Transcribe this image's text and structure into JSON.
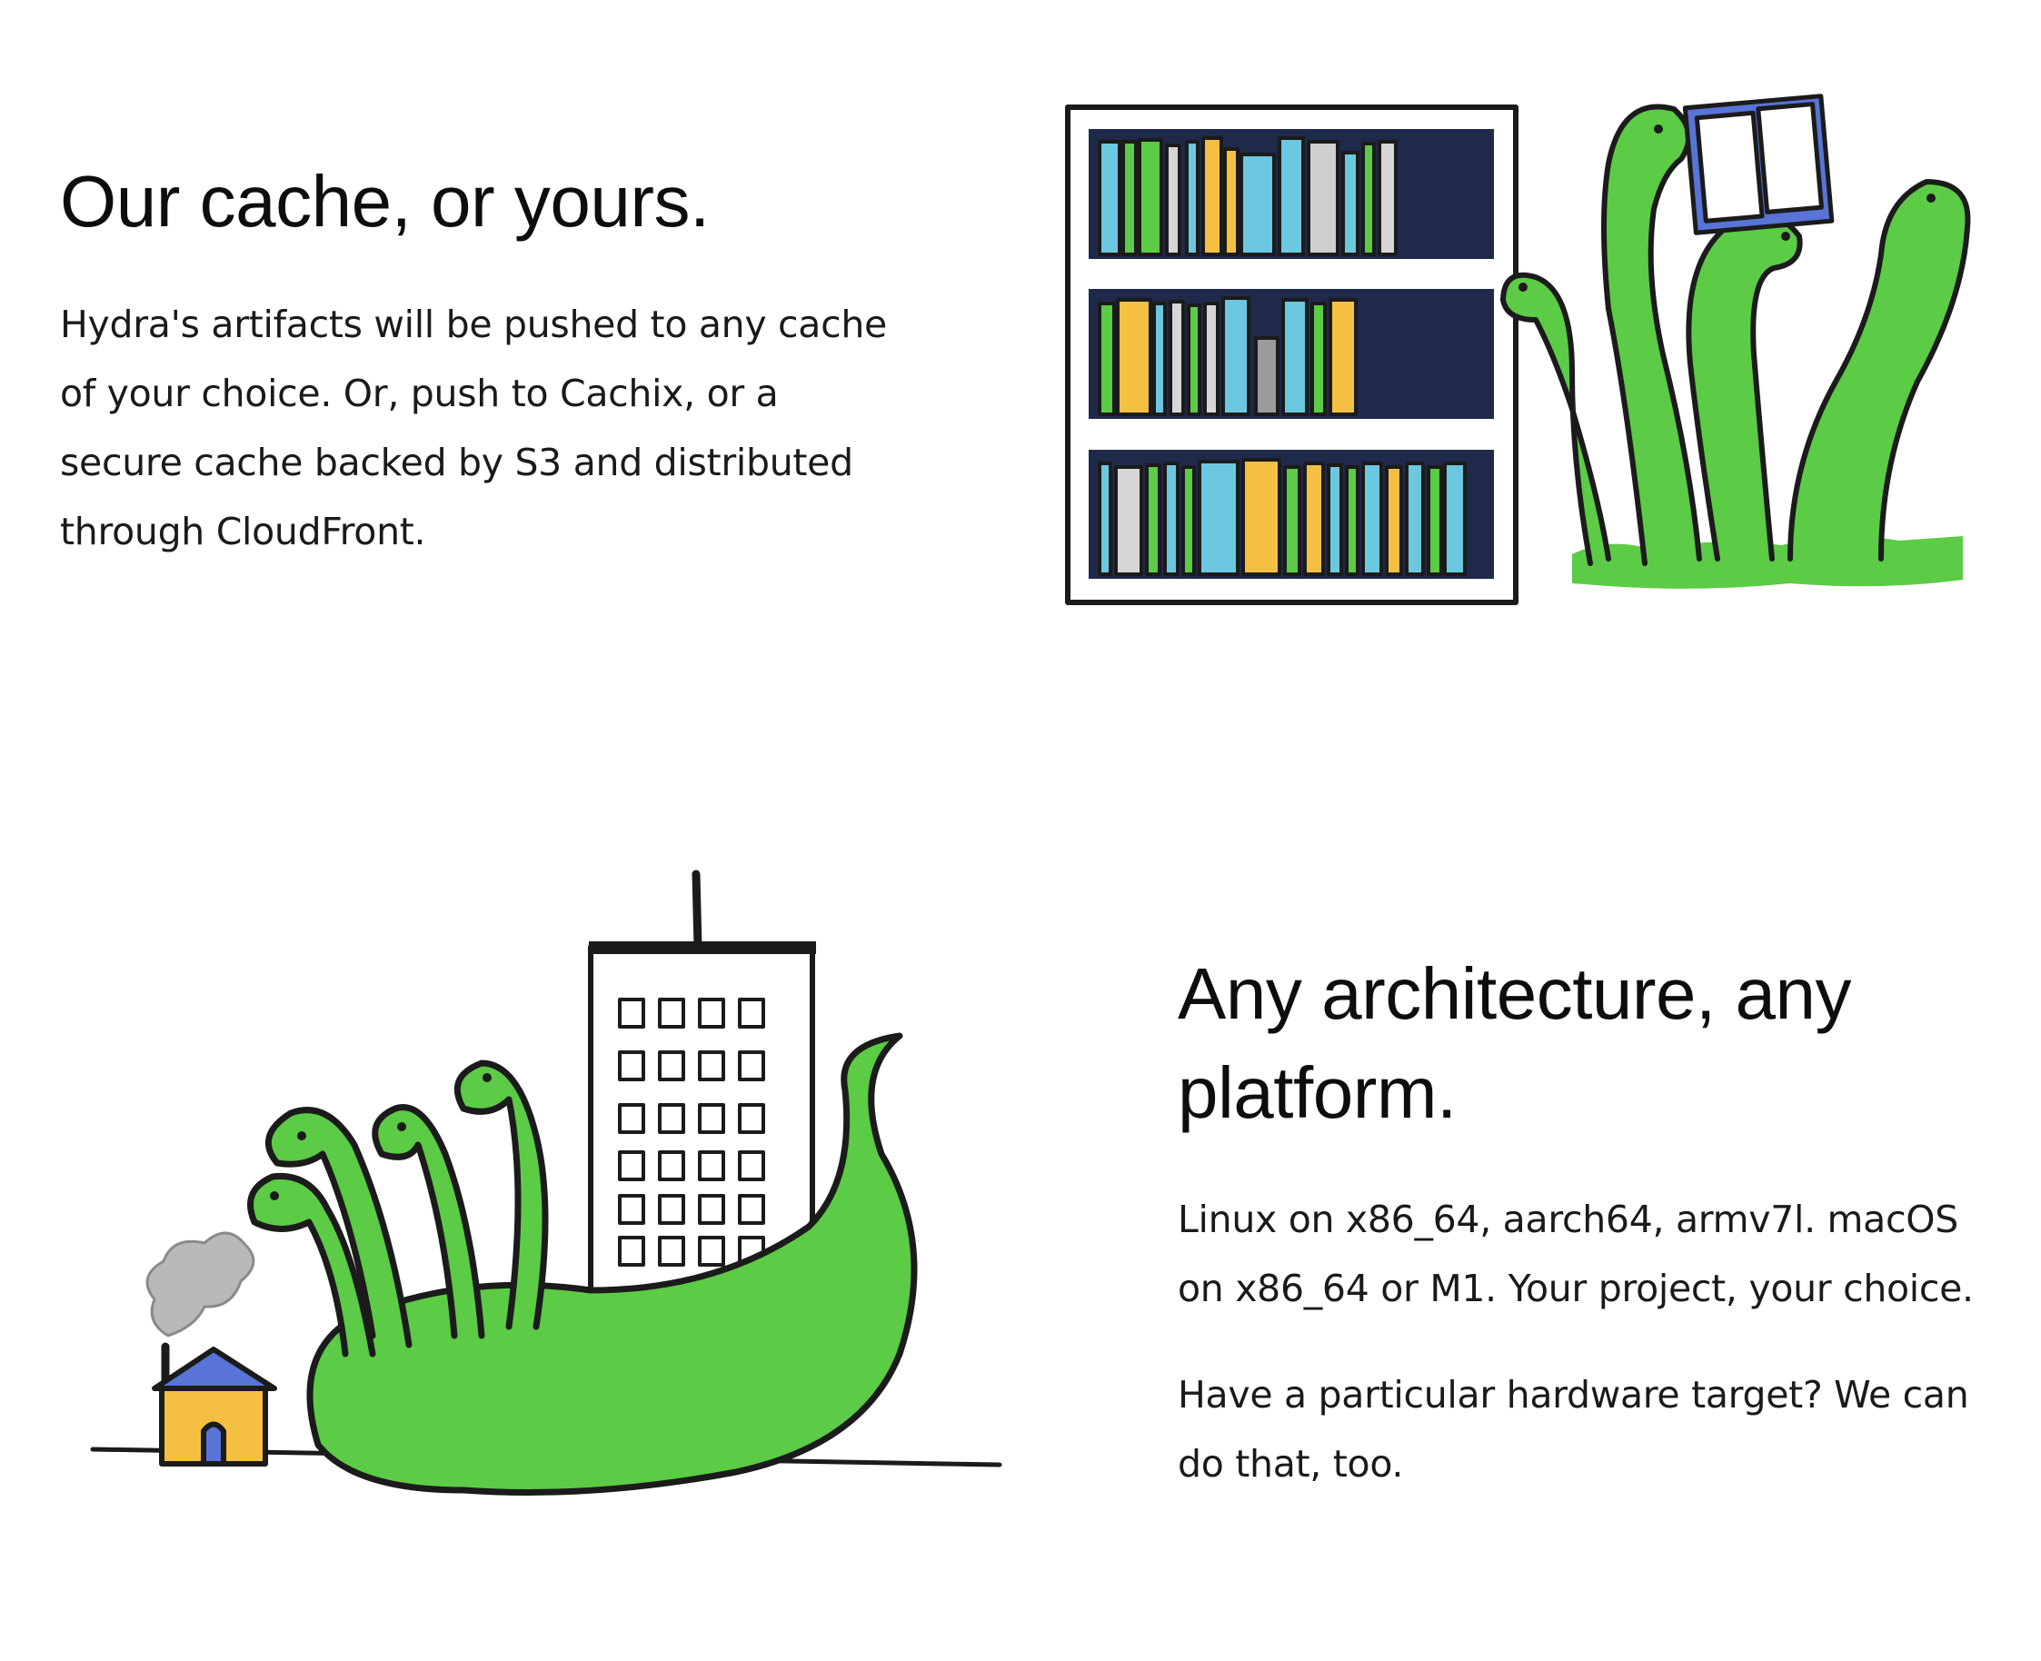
{
  "features": [
    {
      "title": "Our cache, or yours.",
      "paragraphs": [
        "Hydra's artifacts will be pushed to any cache of your choice. Or, push to Cachix, or a secure cache backed by S3 and distributed through CloudFront."
      ],
      "illustration": "hydra-bookshelf-illustration"
    },
    {
      "title": "Any architecture, any platform.",
      "paragraphs": [
        "Linux on x86_64, aarch64, armv7l. macOS on x86_64 or M1. Your project, your choice.",
        "Have a particular hardware target? We can do that, too."
      ],
      "illustration": "hydra-city-illustration"
    }
  ],
  "colors": {
    "hydra_green": "#5ccb45",
    "shelf_blue": "#5774d6",
    "building_cyan": "#6cc8e0",
    "book_yellow": "#f5c042",
    "smoke_gray": "#b9b9b9"
  }
}
